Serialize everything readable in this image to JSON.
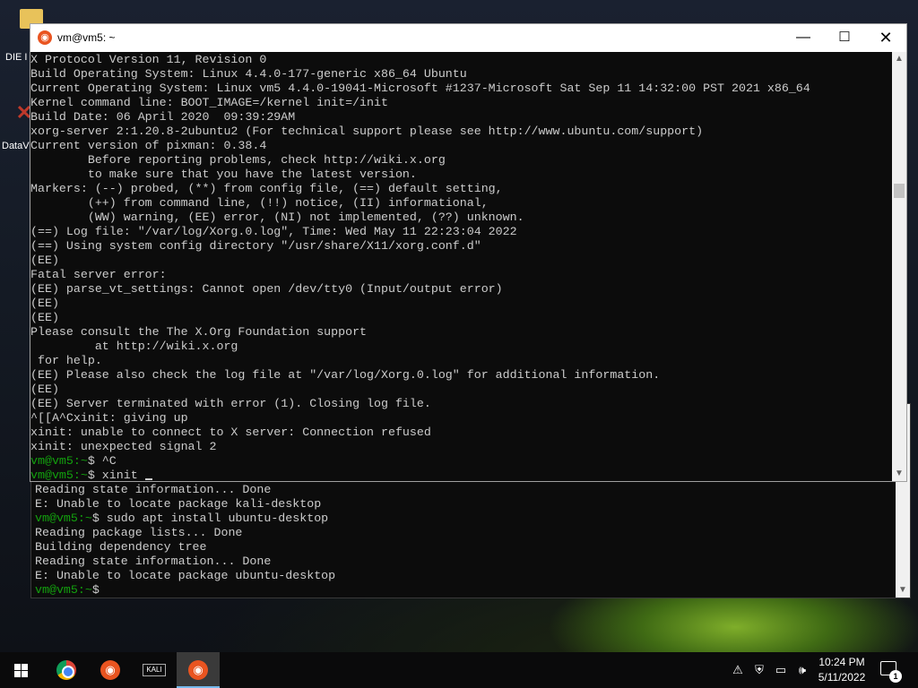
{
  "desktop": {
    "icons": [
      {
        "label": "DIE I",
        "icon": "folder-icon"
      },
      {
        "label": "DataV",
        "icon": "x11-shortcut-icon"
      }
    ]
  },
  "back_terminal": {
    "lines": [
      {
        "text": "Reading state information... Done"
      },
      {
        "text": "E: Unable to locate package kali-desktop"
      },
      {
        "prompt": "vm@vm5:~",
        "text": "$ sudo apt install ubuntu-desktop"
      },
      {
        "text": "Reading package lists... Done"
      },
      {
        "text": "Building dependency tree"
      },
      {
        "text": "Reading state information... Done"
      },
      {
        "text": "E: Unable to locate package ubuntu-desktop"
      },
      {
        "prompt": "vm@vm5:~",
        "text": "$ "
      }
    ]
  },
  "terminal": {
    "title": "vm@vm5: ~",
    "title_icon": "ubuntu-icon",
    "lines": [
      {
        "text": "X Protocol Version 11, Revision 0"
      },
      {
        "text": "Build Operating System: Linux 4.4.0-177-generic x86_64 Ubuntu"
      },
      {
        "text": "Current Operating System: Linux vm5 4.4.0-19041-Microsoft #1237-Microsoft Sat Sep 11 14:32:00 PST 2021 x86_64"
      },
      {
        "text": "Kernel command line: BOOT_IMAGE=/kernel init=/init"
      },
      {
        "text": "Build Date: 06 April 2020  09:39:29AM"
      },
      {
        "text": "xorg-server 2:1.20.8-2ubuntu2 (For technical support please see http://www.ubuntu.com/support)"
      },
      {
        "text": "Current version of pixman: 0.38.4"
      },
      {
        "text": "        Before reporting problems, check http://wiki.x.org"
      },
      {
        "text": "        to make sure that you have the latest version."
      },
      {
        "text": "Markers: (--) probed, (**) from config file, (==) default setting,"
      },
      {
        "text": "        (++) from command line, (!!) notice, (II) informational,"
      },
      {
        "text": "        (WW) warning, (EE) error, (NI) not implemented, (??) unknown."
      },
      {
        "text": "(==) Log file: \"/var/log/Xorg.0.log\", Time: Wed May 11 22:23:04 2022"
      },
      {
        "text": "(==) Using system config directory \"/usr/share/X11/xorg.conf.d\""
      },
      {
        "text": "(EE)"
      },
      {
        "text": "Fatal server error:"
      },
      {
        "text": "(EE) parse_vt_settings: Cannot open /dev/tty0 (Input/output error)"
      },
      {
        "text": "(EE)"
      },
      {
        "text": "(EE)"
      },
      {
        "text": "Please consult the The X.Org Foundation support"
      },
      {
        "text": "         at http://wiki.x.org"
      },
      {
        "text": " for help."
      },
      {
        "text": "(EE) Please also check the log file at \"/var/log/Xorg.0.log\" for additional information."
      },
      {
        "text": "(EE)"
      },
      {
        "text": "(EE) Server terminated with error (1). Closing log file."
      },
      {
        "text": "^[[A^Cxinit: giving up"
      },
      {
        "text": "xinit: unable to connect to X server: Connection refused"
      },
      {
        "text": "xinit: unexpected signal 2"
      },
      {
        "prompt": "vm@vm5:~",
        "text": "$ ^C"
      },
      {
        "prompt": "vm@vm5:~",
        "text": "$ xinit ",
        "cursor": true
      }
    ]
  },
  "taskbar": {
    "apps": [
      {
        "name": "start",
        "icon": "windows-logo-icon"
      },
      {
        "name": "chrome",
        "icon": "chrome-icon"
      },
      {
        "name": "ubuntu",
        "icon": "ubuntu-icon"
      },
      {
        "name": "kali",
        "icon": "kali-icon",
        "label": "KALI"
      },
      {
        "name": "ubuntu-active",
        "icon": "ubuntu-icon",
        "active": true
      }
    ],
    "tray_icons": [
      "network-icon",
      "security-icon",
      "display-icon",
      "volume-icon"
    ],
    "time": "10:24 PM",
    "date": "5/11/2022",
    "notification_count": "1"
  },
  "colors": {
    "terminal_bg": "#0c0c0c",
    "terminal_fg": "#cccccc",
    "prompt": "#13a10e",
    "ubuntu_orange": "#e95420"
  }
}
